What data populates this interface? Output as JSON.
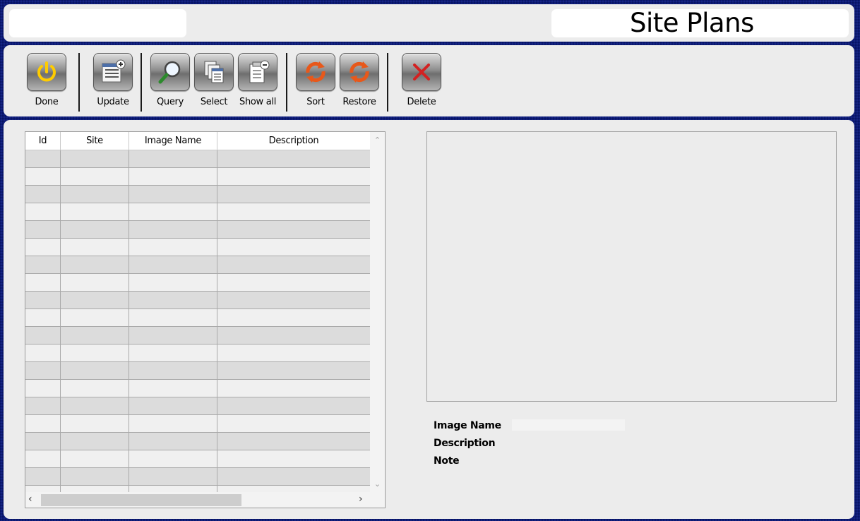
{
  "header": {
    "title": "Site Plans"
  },
  "toolbar": {
    "buttons": [
      {
        "id": "done",
        "label": "Done",
        "icon": "power-icon"
      },
      {
        "id": "update",
        "label": "Update",
        "icon": "list-add-icon"
      },
      {
        "id": "query",
        "label": "Query",
        "icon": "magnifier-icon"
      },
      {
        "id": "select",
        "label": "Select",
        "icon": "copy-pages-icon"
      },
      {
        "id": "show_all",
        "label": "Show all",
        "icon": "document-minus-icon"
      },
      {
        "id": "sort",
        "label": "Sort",
        "icon": "refresh-icon"
      },
      {
        "id": "restore",
        "label": "Restore",
        "icon": "refresh-icon"
      },
      {
        "id": "delete",
        "label": "Delete",
        "icon": "close-x-icon"
      }
    ]
  },
  "grid": {
    "columns": [
      "Id",
      "Site",
      "Image Name",
      "Description"
    ]
  },
  "details": {
    "image_name_label": "Image Name",
    "description_label": "Description",
    "note_label": "Note"
  },
  "colors": {
    "background": "#0b1a78",
    "panel": "#ececec",
    "row_odd": "#dcdcdc",
    "row_even": "#f0f0f0",
    "icon_power": "#ffcc00",
    "icon_sort": "#e8581a",
    "icon_delete": "#d32121"
  }
}
